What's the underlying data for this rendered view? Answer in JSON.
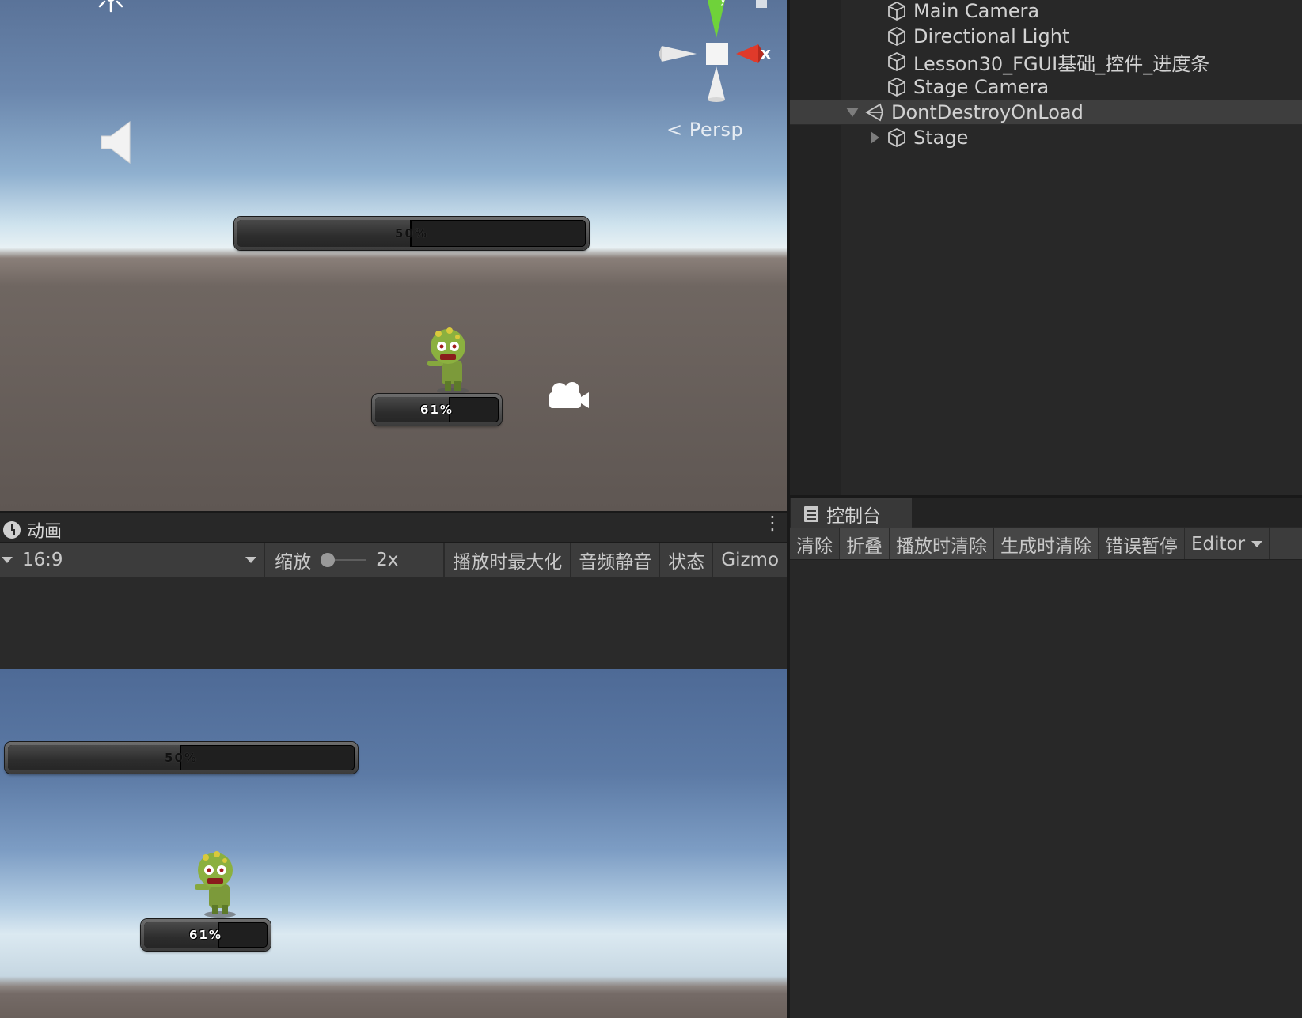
{
  "scene": {
    "persp_label": "Persp",
    "gizmo_x_label": "x",
    "gizmo_y_label": "y",
    "progress_bar_large": {
      "label": "50%",
      "value": 50
    },
    "progress_bar_small": {
      "label": "61%",
      "value": 61
    },
    "icons": [
      "sun-icon",
      "audio-source-icon",
      "scene-gizmo",
      "camera-icon",
      "zombie-sprite"
    ]
  },
  "game": {
    "tab_label": "动画",
    "aspect": "16:9",
    "scale_label": "缩放",
    "scale_value": "2x",
    "buttons": {
      "maximize_on_play": "播放时最大化",
      "mute_audio": "音频静音",
      "stats": "状态",
      "gizmos": "Gizmo"
    },
    "progress_bar_large": {
      "label": "50%",
      "value": 50
    },
    "progress_bar_small": {
      "label": "61%",
      "value": 61
    }
  },
  "hierarchy": {
    "items": [
      {
        "label": "Main Camera"
      },
      {
        "label": "Directional Light"
      },
      {
        "label": "Lesson30_FGUI基础_控件_进度条"
      },
      {
        "label": "Stage Camera"
      },
      {
        "label": "DontDestroyOnLoad"
      },
      {
        "label": "Stage"
      }
    ]
  },
  "console": {
    "tab_label": "控制台",
    "buttons": {
      "clear": "清除",
      "collapse": "折叠",
      "clear_on_play": "播放时清除",
      "clear_on_build": "生成时清除",
      "error_pause": "错误暂停",
      "editor": "Editor"
    }
  },
  "colors": {
    "editor_bg": "#282828",
    "toolbar_bg": "#3c3c3c",
    "selection_row": "#3e3e3e",
    "gizmo_x": "#e03a2a",
    "gizmo_y": "#6fd23a"
  }
}
